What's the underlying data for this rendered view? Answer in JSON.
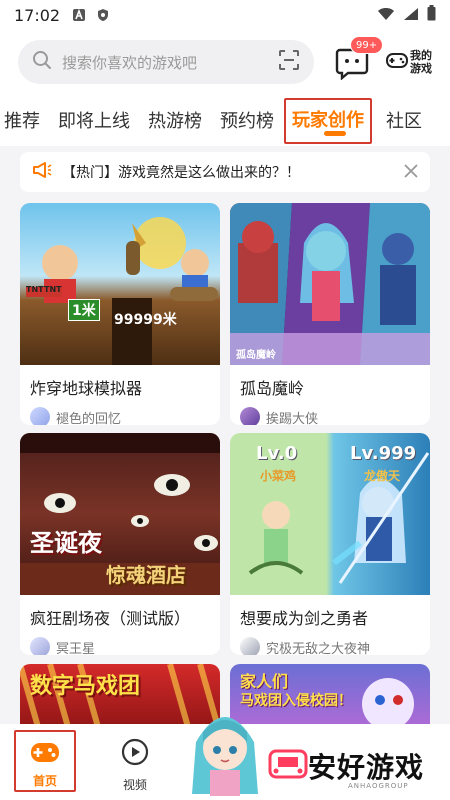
{
  "status_bar": {
    "time": "17:02"
  },
  "search": {
    "placeholder": "搜索你喜欢的游戏吧"
  },
  "header": {
    "message_badge": "99+",
    "my_games_label": "我的游戏"
  },
  "tabs": [
    {
      "label": "推荐"
    },
    {
      "label": "即将上线"
    },
    {
      "label": "热游榜"
    },
    {
      "label": "预约榜"
    },
    {
      "label": "玩家创作",
      "active": true
    },
    {
      "label": "社区"
    }
  ],
  "notice": {
    "text": "【热门】游戏竟然是这么做出来的？！"
  },
  "cards": [
    {
      "title": "炸穿地球模拟器",
      "author": "褪色的回忆",
      "overlays": {
        "a": "1米",
        "b": "99999米",
        "c": "TNT",
        "d": "TNT"
      }
    },
    {
      "title": "孤岛魔岭",
      "author": "挨踢大侠",
      "overlays": {
        "a": "孤岛魔岭"
      }
    },
    {
      "title": "疯狂剧场夜（测试版）",
      "author": "冥王星",
      "overlays": {
        "a": "圣诞夜",
        "b": "惊魂酒店"
      }
    },
    {
      "title": "想要成为剑之勇者",
      "author": "究极无敌之大夜神",
      "overlays": {
        "a": "Lv.0",
        "b": "小菜鸡",
        "c": "Lv.999",
        "d": "龙傲天"
      }
    },
    {
      "overlays": {
        "a": "数字马戏团"
      }
    },
    {
      "overlays": {
        "a": "家人们",
        "b": "马戏团入侵校园！"
      }
    }
  ],
  "bottom_nav": {
    "home_label": "首页",
    "video_label": "视频"
  },
  "watermark": {
    "text": "安好游戏",
    "sub": "ANHAOGROUP"
  },
  "colors": {
    "accent": "#ff7a00",
    "highlight_box": "#d43b2f",
    "badge": "#ff5a5a"
  }
}
